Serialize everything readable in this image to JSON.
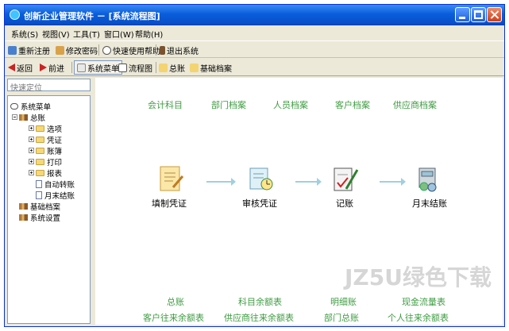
{
  "window": {
    "title": "创新企业管理软件 － [系统流程图]"
  },
  "menu": [
    "系统(S)",
    "视图(V)",
    "工具(T)",
    "窗口(W)",
    "帮助(H)"
  ],
  "toolbar1": [
    "重新注册",
    "修改密码",
    "快速使用帮助",
    "退出系统"
  ],
  "toolbar2": [
    "返回",
    "前进",
    "系统菜单",
    "流程图",
    "总账",
    "基础档案"
  ],
  "left": {
    "search_placeholder": "快速定位",
    "tree": {
      "root": "系统菜单",
      "ledger": "总账",
      "ledger_children": [
        "选项",
        "凭证",
        "账簿",
        "打印",
        "报表"
      ],
      "ledger_docs": [
        "自动转账",
        "月末结账"
      ],
      "others": [
        "基础档案",
        "系统设置"
      ]
    }
  },
  "flow": {
    "top_links": [
      "会计科目",
      "部门档案",
      "人员档案",
      "客户档案",
      "供应商档案"
    ],
    "steps": [
      "填制凭证",
      "审核凭证",
      "记账",
      "月末结账"
    ],
    "bottom_links_row1": [
      "总账",
      "科目余额表",
      "明细账",
      "现金流量表"
    ],
    "bottom_links_row2": [
      "客户往来余额表",
      "供应商往来余额表",
      "部门总账",
      "个人往来余额表"
    ]
  },
  "watermark": "JZ5U绿色下载",
  "colors": {
    "link": "#3f9c42",
    "title_blue": "#0a5ddb",
    "chrome": "#ece9d8"
  }
}
